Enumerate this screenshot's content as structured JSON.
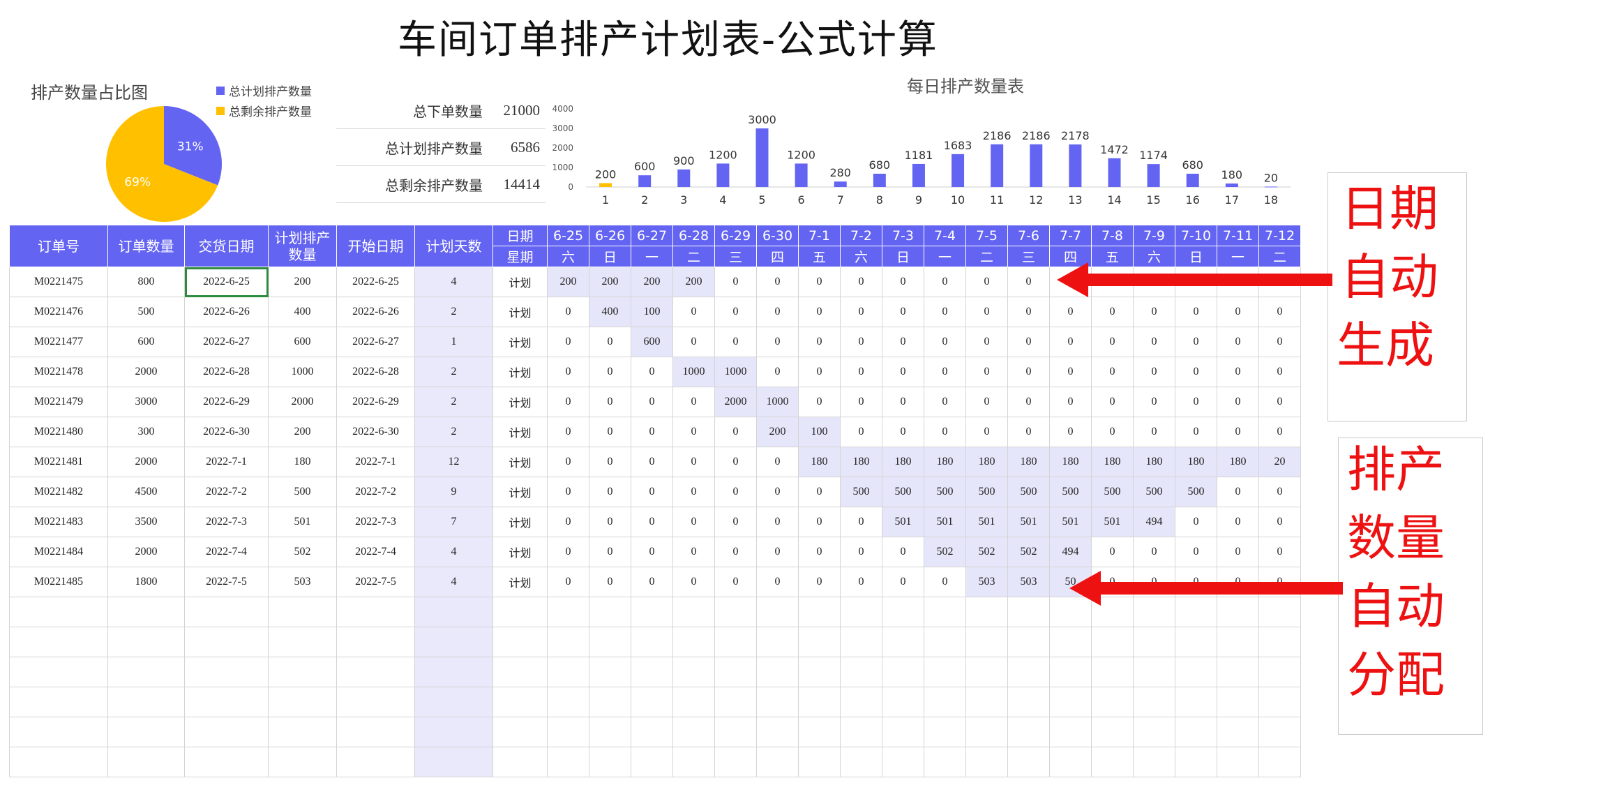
{
  "title": "车间订单排产计划表-公式计算",
  "pie": {
    "title": "排产数量占比图",
    "legend": [
      {
        "label": "总计划排产数量",
        "color": "#6464f2"
      },
      {
        "label": "总剩余排产数量",
        "color": "#ffc000"
      }
    ],
    "slices": [
      {
        "label": "31%",
        "value": 31,
        "color": "#6464f2"
      },
      {
        "label": "69%",
        "value": 69,
        "color": "#ffc000"
      }
    ]
  },
  "summary": [
    {
      "label": "总下单数量",
      "value": "21000"
    },
    {
      "label": "总计划排产数量",
      "value": "6586"
    },
    {
      "label": "总剩余排产数量",
      "value": "14414"
    }
  ],
  "chart_data": {
    "type": "bar",
    "title": "每日排产数量表",
    "categories": [
      "1",
      "2",
      "3",
      "4",
      "5",
      "6",
      "7",
      "8",
      "9",
      "10",
      "11",
      "12",
      "13",
      "14",
      "15",
      "16",
      "17",
      "18"
    ],
    "values": [
      200,
      600,
      900,
      1200,
      3000,
      1200,
      280,
      680,
      1181,
      1683,
      2186,
      2186,
      2178,
      1472,
      1174,
      680,
      180,
      20
    ],
    "highlight_index": 0,
    "ylim": [
      0,
      4000
    ],
    "yticks": [
      "0",
      "1000",
      "2000",
      "3000",
      "4000"
    ],
    "colors": {
      "bar": "#6464f2",
      "highlight": "#ffc000"
    }
  },
  "table": {
    "headers": [
      "订单号",
      "订单数量",
      "交货日期",
      "计划排产数量",
      "开始日期",
      "计划天数"
    ],
    "header_date_label": "日期",
    "header_week_label": "星期",
    "dates": [
      "6-25",
      "6-26",
      "6-27",
      "6-28",
      "6-29",
      "6-30",
      "7-1",
      "7-2",
      "7-3",
      "7-4",
      "7-5",
      "7-6",
      "7-7",
      "7-8",
      "7-9",
      "7-10",
      "7-11",
      "7-12"
    ],
    "weekdays": [
      "六",
      "日",
      "一",
      "二",
      "三",
      "四",
      "五",
      "六",
      "日",
      "一",
      "二",
      "三",
      "四",
      "五",
      "六",
      "日",
      "一",
      "二"
    ],
    "plan_label": "计划",
    "rows": [
      {
        "order": "M0221475",
        "qty": "800",
        "due": "2022-6-25",
        "plan": "200",
        "start": "2022-6-25",
        "days": "4",
        "daily": [
          200,
          200,
          200,
          200,
          0,
          0,
          0,
          0,
          0,
          0,
          0,
          0,
          0,
          0,
          0,
          0,
          0,
          0
        ]
      },
      {
        "order": "M0221476",
        "qty": "500",
        "due": "2022-6-26",
        "plan": "400",
        "start": "2022-6-26",
        "days": "2",
        "daily": [
          0,
          400,
          100,
          0,
          0,
          0,
          0,
          0,
          0,
          0,
          0,
          0,
          0,
          0,
          0,
          0,
          0,
          0
        ]
      },
      {
        "order": "M0221477",
        "qty": "600",
        "due": "2022-6-27",
        "plan": "600",
        "start": "2022-6-27",
        "days": "1",
        "daily": [
          0,
          0,
          600,
          0,
          0,
          0,
          0,
          0,
          0,
          0,
          0,
          0,
          0,
          0,
          0,
          0,
          0,
          0
        ]
      },
      {
        "order": "M0221478",
        "qty": "2000",
        "due": "2022-6-28",
        "plan": "1000",
        "start": "2022-6-28",
        "days": "2",
        "daily": [
          0,
          0,
          0,
          1000,
          1000,
          0,
          0,
          0,
          0,
          0,
          0,
          0,
          0,
          0,
          0,
          0,
          0,
          0
        ]
      },
      {
        "order": "M0221479",
        "qty": "3000",
        "due": "2022-6-29",
        "plan": "2000",
        "start": "2022-6-29",
        "days": "2",
        "daily": [
          0,
          0,
          0,
          0,
          2000,
          1000,
          0,
          0,
          0,
          0,
          0,
          0,
          0,
          0,
          0,
          0,
          0,
          0
        ]
      },
      {
        "order": "M0221480",
        "qty": "300",
        "due": "2022-6-30",
        "plan": "200",
        "start": "2022-6-30",
        "days": "2",
        "daily": [
          0,
          0,
          0,
          0,
          0,
          200,
          100,
          0,
          0,
          0,
          0,
          0,
          0,
          0,
          0,
          0,
          0,
          0
        ]
      },
      {
        "order": "M0221481",
        "qty": "2000",
        "due": "2022-7-1",
        "plan": "180",
        "start": "2022-7-1",
        "days": "12",
        "daily": [
          0,
          0,
          0,
          0,
          0,
          0,
          180,
          180,
          180,
          180,
          180,
          180,
          180,
          180,
          180,
          180,
          180,
          20
        ]
      },
      {
        "order": "M0221482",
        "qty": "4500",
        "due": "2022-7-2",
        "plan": "500",
        "start": "2022-7-2",
        "days": "9",
        "daily": [
          0,
          0,
          0,
          0,
          0,
          0,
          0,
          500,
          500,
          500,
          500,
          500,
          500,
          500,
          500,
          500,
          0,
          0
        ]
      },
      {
        "order": "M0221483",
        "qty": "3500",
        "due": "2022-7-3",
        "plan": "501",
        "start": "2022-7-3",
        "days": "7",
        "daily": [
          0,
          0,
          0,
          0,
          0,
          0,
          0,
          0,
          501,
          501,
          501,
          501,
          501,
          501,
          494,
          0,
          0,
          0
        ]
      },
      {
        "order": "M0221484",
        "qty": "2000",
        "due": "2022-7-4",
        "plan": "502",
        "start": "2022-7-4",
        "days": "4",
        "daily": [
          0,
          0,
          0,
          0,
          0,
          0,
          0,
          0,
          0,
          502,
          502,
          502,
          494,
          0,
          0,
          0,
          0,
          0
        ]
      },
      {
        "order": "M0221485",
        "qty": "1800",
        "due": "2022-7-5",
        "plan": "503",
        "start": "2022-7-5",
        "days": "4",
        "daily": [
          0,
          0,
          0,
          0,
          0,
          0,
          0,
          0,
          0,
          0,
          503,
          503,
          50,
          0,
          0,
          0,
          0,
          0
        ]
      }
    ],
    "empty_rows": 6
  },
  "notes": [
    {
      "lines": [
        "日期",
        "自动",
        "生成"
      ]
    },
    {
      "lines": [
        "排产",
        "数量",
        "自动",
        "分配"
      ]
    }
  ]
}
